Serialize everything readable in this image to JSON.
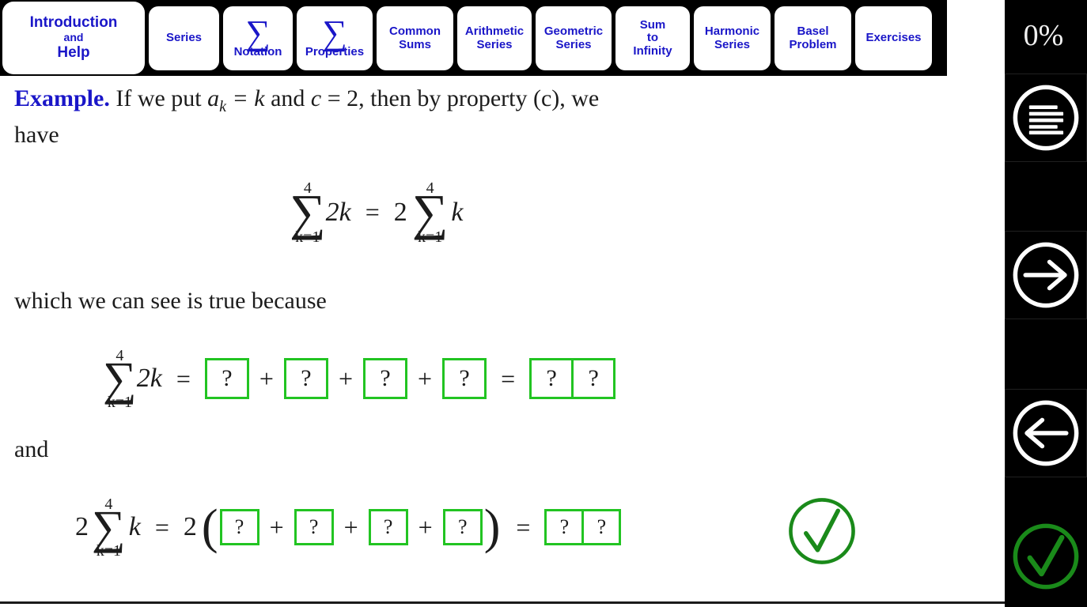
{
  "nav": {
    "buttons": [
      {
        "id": "introduction-help",
        "lines": [
          "Introduction",
          "and",
          "Help"
        ],
        "icon": null
      },
      {
        "id": "series",
        "lines": [
          "Series"
        ],
        "icon": null
      },
      {
        "id": "notation",
        "lines": [
          "Notation"
        ],
        "icon": "sigma-icon"
      },
      {
        "id": "properties",
        "lines": [
          "Properties"
        ],
        "icon": "sigma-icon"
      },
      {
        "id": "common-sums",
        "lines": [
          "Common",
          "Sums"
        ],
        "icon": null
      },
      {
        "id": "arithmetic-series",
        "lines": [
          "Arithmetic",
          "Series"
        ],
        "icon": null
      },
      {
        "id": "geometric-series",
        "lines": [
          "Geometric",
          "Series"
        ],
        "icon": null
      },
      {
        "id": "sum-to-infinity",
        "lines": [
          "Sum",
          "to",
          "Infinity"
        ],
        "icon": null
      },
      {
        "id": "harmonic-series",
        "lines": [
          "Harmonic",
          "Series"
        ],
        "icon": null
      },
      {
        "id": "basel-problem",
        "lines": [
          "Basel",
          "Problem"
        ],
        "icon": null
      },
      {
        "id": "exercises",
        "lines": [
          "Exercises"
        ],
        "icon": null
      }
    ],
    "labels": {
      "introduction": "Introduction",
      "and": "and",
      "help": "Help",
      "series": "Series",
      "notation": "Notation",
      "properties": "Properties",
      "common": "Common",
      "sums": "Sums",
      "arithmetic": "Arithmetic",
      "arithmetic_series": "Series",
      "geometric": "Geometric",
      "geometric_series": "Series",
      "sum": "Sum",
      "to": "to",
      "infinity": "Infinity",
      "harmonic": "Harmonic",
      "harmonic_series": "Series",
      "basel": "Basel",
      "problem": "Problem",
      "exercises": "Exercises",
      "sigma": "∑"
    },
    "colors": {
      "background": "#000000",
      "button_bg": "#ffffff",
      "button_text": "#1a16c8"
    }
  },
  "sidebar": {
    "progress": "0%",
    "items": [
      {
        "id": "progress",
        "label": "0%",
        "icon": null
      },
      {
        "id": "menu",
        "label": "",
        "icon": "menu-icon"
      },
      {
        "id": "next",
        "label": "",
        "icon": "arrow-right-icon"
      },
      {
        "id": "previous",
        "label": "",
        "icon": "arrow-left-icon"
      },
      {
        "id": "check-answer",
        "label": "",
        "icon": "check-circle-icon"
      }
    ],
    "colors": {
      "background": "#000000",
      "icon": "#ffffff",
      "check": "#1a8a1a",
      "text": "#f0f0f0"
    }
  },
  "main": {
    "example_lead": "Example.",
    "example_text_1": "If we put",
    "example_ak": "a",
    "example_ak_sub": "k",
    "example_eq1": "= k",
    "example_text_2": "and",
    "example_c": "c",
    "example_eq2": "= 2,",
    "example_text_3": "then by property (c), we",
    "have_text": "have",
    "because_text": "which we can see is true because",
    "and_text": "and",
    "equation_1": {
      "sum_upper": "4",
      "sum_lower": "k=1",
      "sum_symbol": "∑",
      "left_body": "2k",
      "equals": "=",
      "right_coeff": "2",
      "right_body": "k",
      "right_sum_upper": "4",
      "right_sum_lower": "k=1"
    },
    "equation_2": {
      "sum_upper": "4",
      "sum_lower": "k=1",
      "sum_symbol": "∑",
      "body": "2k",
      "equals": "=",
      "plus": "+",
      "terms": [
        "?",
        "?",
        "?",
        "?"
      ],
      "result": [
        "?",
        "?"
      ]
    },
    "equation_3": {
      "coeff": "2",
      "sum_upper": "4",
      "sum_lower": "k=1",
      "sum_symbol": "∑",
      "body": "k",
      "equals": "=",
      "outer_coeff": "2",
      "open_paren": "(",
      "close_paren": ")",
      "plus": "+",
      "terms": [
        "?",
        "?",
        "?",
        "?"
      ],
      "result": [
        "?",
        "?"
      ]
    },
    "check_icon": "check-circle-icon",
    "colors": {
      "answer_box_border": "#22c422",
      "heading": "#1a16c8",
      "body_text": "#1c1c1c",
      "check_green": "#1a8a1a",
      "page_bg": "#ffffff"
    }
  }
}
